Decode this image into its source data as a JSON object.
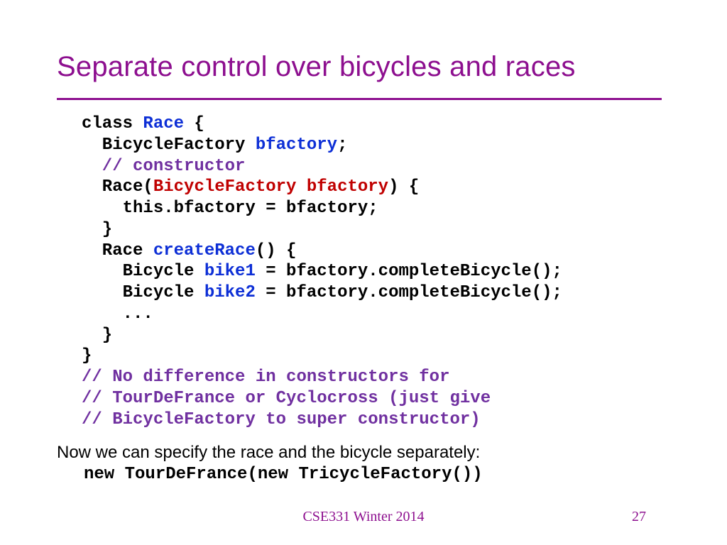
{
  "title": "Separate control over bicycles and races",
  "code": {
    "l1a": "class ",
    "l1b": "Race",
    "l1c": " {",
    "l2a": "  BicycleFactory ",
    "l2b": "bfactory",
    "l2c": ";",
    "l3": "  // constructor",
    "l4a": "  Race(",
    "l4b": "BicycleFactory bfactory",
    "l4c": ") {",
    "l5": "    this.bfactory = bfactory;",
    "l6": "  }",
    "l7a": "  Race ",
    "l7b": "createRace",
    "l7c": "() {",
    "l8a": "    Bicycle ",
    "l8b": "bike1",
    "l8c": " = bfactory.completeBicycle();",
    "l9a": "    Bicycle ",
    "l9b": "bike2",
    "l9c": " = bfactory.completeBicycle();",
    "l10": "    ...",
    "l11": "  }",
    "l12": "}",
    "l13": "// No difference in constructors for",
    "l14": "// TourDeFrance or Cyclocross (just give",
    "l15": "// BicycleFactory to super constructor)"
  },
  "explain": {
    "line1": "Now we can specify the race and the bicycle separately:",
    "line2": "new TourDeFrance(new TricycleFactory())"
  },
  "footer": {
    "course": "CSE331 Winter 2014",
    "page": "27"
  }
}
